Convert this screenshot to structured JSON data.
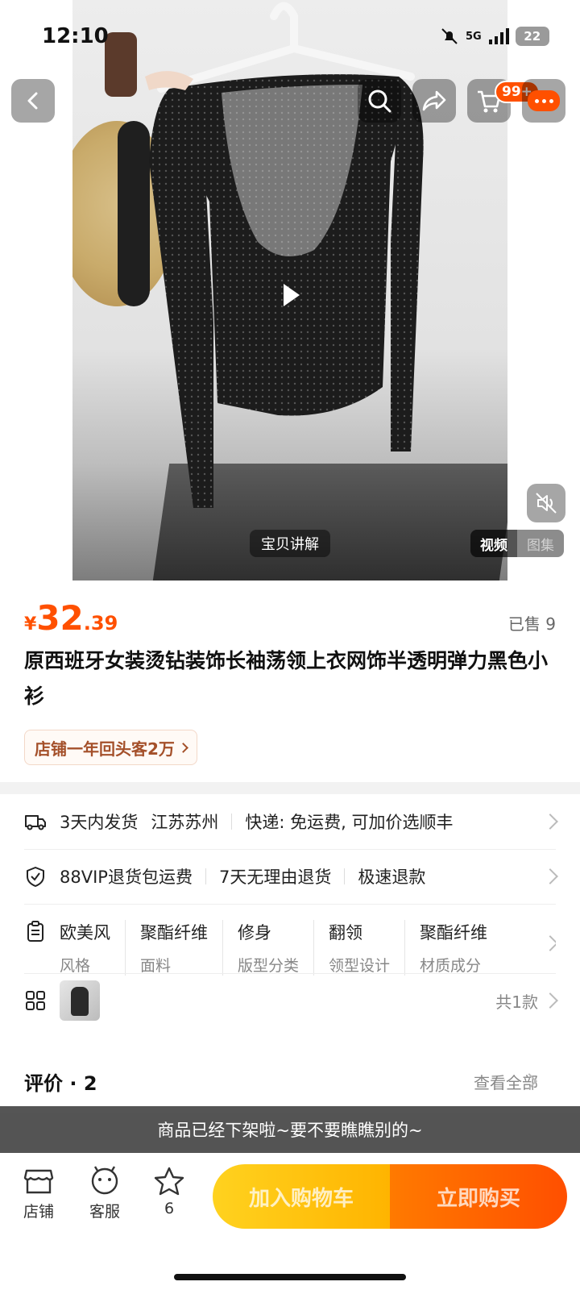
{
  "status_bar": {
    "time": "12:10",
    "network": "5G",
    "battery": "22"
  },
  "header": {
    "cart_badge": "99+"
  },
  "media": {
    "explain_label": "宝贝讲解",
    "tab_video": "视频",
    "tab_gallery": "图集"
  },
  "product": {
    "currency": "¥",
    "price_int": "32",
    "price_dec": ".39",
    "sold": "已售 9",
    "title": "原西班牙女装烫钻装饰长袖荡领上衣网饰半透明弹力黑色小衫",
    "returning_tag": "店铺一年回头客2万"
  },
  "shipping": {
    "items": [
      "3天内发货",
      "江苏苏州",
      "快递: 免运费, 可加价选顺丰"
    ]
  },
  "guarantee": {
    "items": [
      "88VIP退货包运费",
      "7天无理由退货",
      "极速退款"
    ]
  },
  "specs": [
    {
      "value": "欧美风",
      "key": "风格"
    },
    {
      "value": "聚酯纤维",
      "key": "面料"
    },
    {
      "value": "修身",
      "key": "版型分类"
    },
    {
      "value": "翻领",
      "key": "领型设计"
    },
    {
      "value": "聚酯纤维",
      "key": "材质成分"
    }
  ],
  "variants": {
    "count_label": "共1款"
  },
  "reviews": {
    "title": "评价 · 2",
    "view_all": "查看全部"
  },
  "banner": {
    "text": "商品已经下架啦~要不要瞧瞧别的~"
  },
  "bottom_bar": {
    "store": "店铺",
    "service": "客服",
    "favorite_count": "6",
    "add_cart": "加入购物车",
    "buy_now": "立即购买"
  },
  "colors": {
    "accent": "#ff5000",
    "cart_yellow": "#ffc20e",
    "buy_orange": "#ff6000"
  }
}
